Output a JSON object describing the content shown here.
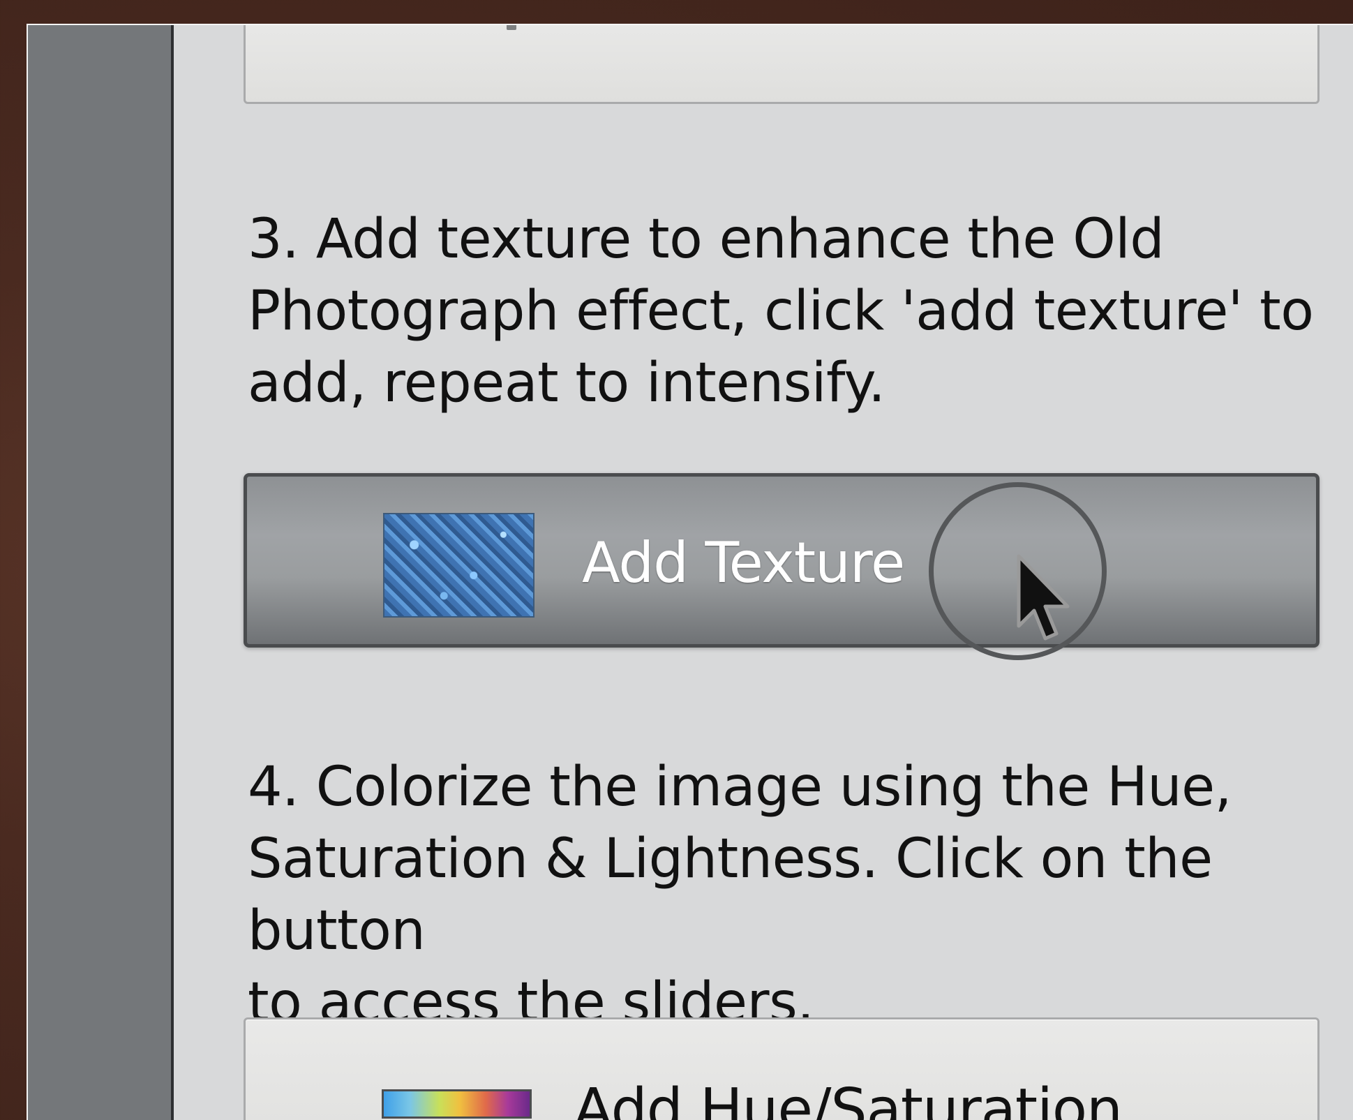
{
  "steps": {
    "step3": {
      "text_line1": "3. Add texture to enhance the Old",
      "text_line2": "Photograph effect, click 'add texture' to",
      "text_line3": "add, repeat to intensify."
    },
    "step4": {
      "text_line1": "4. Colorize the image using the Hue,",
      "text_line2": "Saturation & Lightness. Click on the button",
      "text_line3": "to access the sliders."
    }
  },
  "buttons": {
    "add_texture": {
      "label": "Add Texture",
      "icon": "texture-thumbnail-icon"
    },
    "add_hue_saturation": {
      "label": "Add Hue/Saturation",
      "icon": "hue-gradient-icon"
    }
  },
  "colors": {
    "background": "#4a2a20",
    "panel": "#d8d9da",
    "sidebar": "#74777a",
    "dark_button": "#9a9d9f",
    "text": "#111111"
  }
}
